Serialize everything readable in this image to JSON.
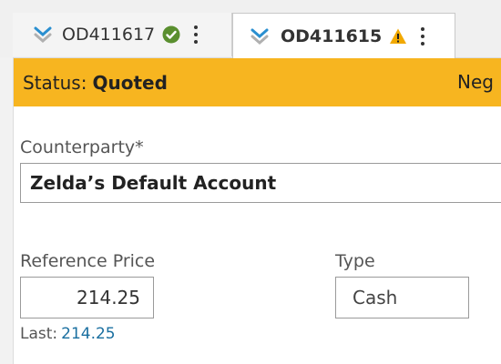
{
  "tabs": [
    {
      "label": "OD411617",
      "status_icon": "check-circle-icon",
      "status_color": "#5a8f2f",
      "active": false
    },
    {
      "label": "OD411615",
      "status_icon": "warning-icon",
      "status_color": "#f2a900",
      "active": true
    }
  ],
  "status_bar": {
    "label": "Status:",
    "value": "Quoted",
    "right_text": "Neg",
    "color": "#f7b520"
  },
  "form": {
    "counterparty_label": "Counterparty*",
    "counterparty_value": "Zelda’s Default Account",
    "reference_price_label": "Reference Price",
    "reference_price_value": "214.25",
    "type_label": "Type",
    "type_value": "Cash",
    "last_label": "Last:",
    "last_value": "214.25"
  },
  "colors": {
    "chevron": "#2a8fd0",
    "link": "#1a6fa0"
  }
}
